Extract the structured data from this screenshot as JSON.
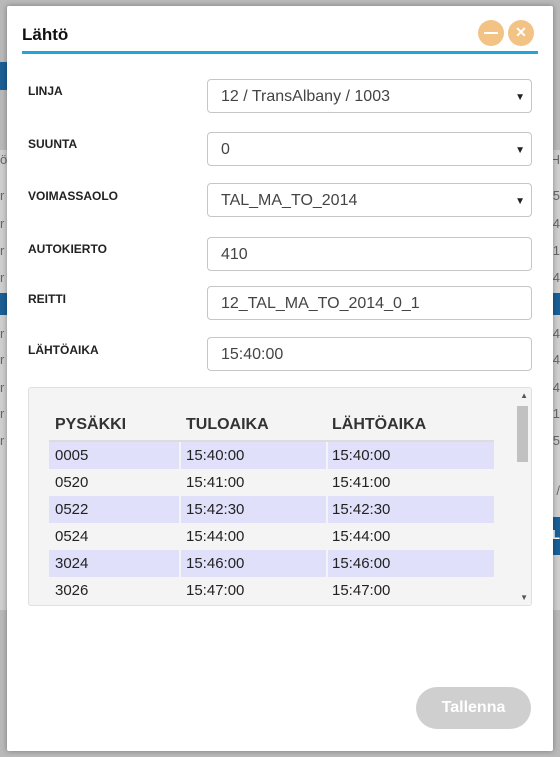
{
  "dialog": {
    "title": "Lähtö",
    "minimize_label": "—",
    "close_label": "✕"
  },
  "form": {
    "linja": {
      "label": "LINJA",
      "value": "12 / TransAlbany / 1003"
    },
    "suunta": {
      "label": "SUUNTA",
      "value": "0"
    },
    "voimassaolo": {
      "label": "VOIMASSAOLO",
      "value": "TAL_MA_TO_2014"
    },
    "autokierto": {
      "label": "AUTOKIERTO",
      "value": "410"
    },
    "reitti": {
      "label": "REITTI",
      "value": "12_TAL_MA_TO_2014_0_1"
    },
    "lahtoaika": {
      "label": "LÄHTÖAIKA",
      "value": "15:40:00"
    }
  },
  "stops_table": {
    "headers": [
      "PYSÄKKI",
      "TULOAIKA",
      "LÄHTÖAIKA"
    ],
    "rows": [
      [
        "0005",
        "15:40:00",
        "15:40:00"
      ],
      [
        "0520",
        "15:41:00",
        "15:41:00"
      ],
      [
        "0522",
        "15:42:30",
        "15:42:30"
      ],
      [
        "0524",
        "15:44:00",
        "15:44:00"
      ],
      [
        "3024",
        "15:46:00",
        "15:46:00"
      ],
      [
        "3026",
        "15:47:00",
        "15:47:00"
      ]
    ]
  },
  "actions": {
    "save_label": "Tallenna"
  },
  "background": {
    "left_chars": [
      "ö",
      "r",
      "r",
      "r",
      "r",
      "r",
      "r",
      "r",
      "r",
      "r"
    ],
    "right_chars": [
      "H",
      "5",
      "4",
      "1",
      "4",
      "4",
      "4",
      "4",
      "1",
      "5",
      "/",
      "L"
    ]
  },
  "colors": {
    "accent": "#25a4d6",
    "header_button": "#f2c384",
    "row_highlight": "#e0e0fa",
    "save_disabled": "#cfcfcf"
  }
}
